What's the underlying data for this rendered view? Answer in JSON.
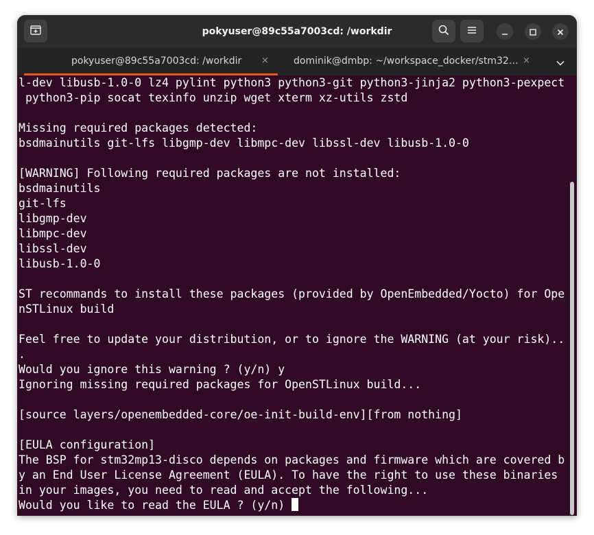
{
  "window": {
    "title": "pokyuser@89c55a7003cd: /workdir"
  },
  "header_icons": {
    "new_tab": "new-tab-icon",
    "search": "search-icon",
    "menu": "hamburger-icon",
    "minimize": "minimize-icon",
    "maximize": "maximize-icon",
    "close": "close-icon"
  },
  "tabs": [
    {
      "label": "pokyuser@89c55a7003cd: /workdir",
      "close": "×",
      "active": true
    },
    {
      "label": "dominik@dmbp: ~/workspace_docker/stm32…",
      "close": "×",
      "active": false
    }
  ],
  "tabs_dropdown": "chevron-down-icon",
  "colors": {
    "terminal_bg": "#300a24",
    "titlebar_bg": "#2b2b2b",
    "tabbar_bg": "#242424",
    "accent": "#e95420",
    "text": "#ffffff"
  },
  "terminal": {
    "lines": [
      "l-dev libusb-1.0-0 lz4 pylint python3 python3-git python3-jinja2 python3-pexpect",
      " python3-pip socat texinfo unzip wget xterm xz-utils zstd",
      "",
      "Missing required packages detected:",
      "bsdmainutils git-lfs libgmp-dev libmpc-dev libssl-dev libusb-1.0-0",
      "",
      "[WARNING] Following required packages are not installed:",
      "bsdmainutils",
      "git-lfs",
      "libgmp-dev",
      "libmpc-dev",
      "libssl-dev",
      "libusb-1.0-0",
      "",
      "ST recommands to install these packages (provided by OpenEmbedded/Yocto) for Ope",
      "nSTLinux build",
      "",
      "Feel free to update your distribution, or to ignore the WARNING (at your risk)..",
      ".",
      "Would you ignore this warning ? (y/n) y",
      "Ignoring missing required packages for OpenSTLinux build...",
      "",
      "[source layers/openembedded-core/oe-init-build-env][from nothing]",
      "",
      "[EULA configuration]",
      "The BSP for stm32mp13-disco depends on packages and firmware which are covered b",
      "y an End User License Agreement (EULA). To have the right to use these binaries",
      "in your images, you need to read and accept the following...",
      "Would you like to read the EULA ? (y/n) "
    ]
  }
}
